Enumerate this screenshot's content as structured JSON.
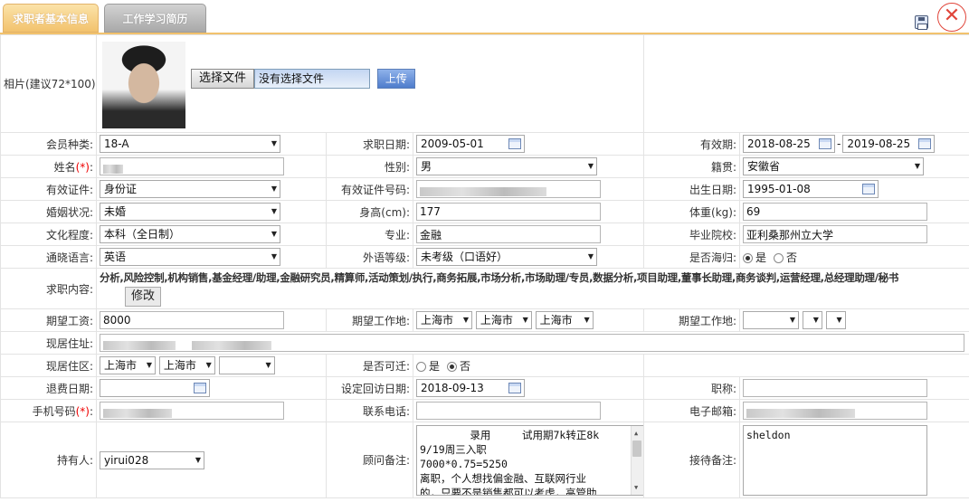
{
  "tabs": [
    "求职者基本信息",
    "工作学习简历"
  ],
  "photo": {
    "label": "相片(建议72*100):",
    "choose_btn": "选择文件",
    "file_status": "没有选择文件",
    "upload_btn": "上传"
  },
  "row1": {
    "member_type_label": "会员种类:",
    "member_type": "18-A",
    "apply_date_label": "求职日期:",
    "apply_date": "2009-05-01",
    "valid_label": "有效期:",
    "valid_from": "2018-08-25",
    "dash": "-",
    "valid_to": "2019-08-25"
  },
  "row2": {
    "name_label": "姓名",
    "req": "(*)",
    "colon": ":",
    "gender_label": "性别:",
    "gender": "男",
    "origin_label": "籍贯:",
    "origin": "安徽省"
  },
  "row3": {
    "id_type_label": "有效证件:",
    "id_type": "身份证",
    "id_no_label": "有效证件号码:",
    "birth_label": "出生日期:",
    "birth": "1995-01-08"
  },
  "row4": {
    "marital_label": "婚姻状况:",
    "marital": "未婚",
    "height_label": "身高(cm):",
    "height": "177",
    "weight_label": "体重(kg):",
    "weight": "69"
  },
  "row5": {
    "edu_label": "文化程度:",
    "edu": "本科（全日制）",
    "major_label": "专业:",
    "major": "金融",
    "school_label": "毕业院校:",
    "school": "亚利桑那州立大学"
  },
  "row6": {
    "lang_label": "通晓语言:",
    "lang": "英语",
    "lang_level_label": "外语等级:",
    "lang_level": "未考级（口语好）",
    "overseas_label": "是否海归:",
    "yes": "是",
    "no": "否"
  },
  "row7": {
    "jobs_label": "求职内容:",
    "jobs": "分析,风险控制,机构销售,基金经理/助理,金融研究员,精算师,活动策划/执行,商务拓展,市场分析,市场助理/专员,数据分析,项目助理,董事长助理,商务谈判,运营经理,总经理助理/秘书",
    "edit_btn": "修改"
  },
  "row8": {
    "salary_label": "期望工资:",
    "salary": "8000",
    "workplace_label": "期望工作地:",
    "wp1": "上海市",
    "wp2": "上海市",
    "wp3": "上海市",
    "workplace2_label": "期望工作地:"
  },
  "row9": {
    "address_label": "现居住址:"
  },
  "row10": {
    "district_label": "现居住区:",
    "d1": "上海市",
    "d2": "上海市",
    "relocate_label": "是否可迁:",
    "yes": "是",
    "no": "否"
  },
  "row11": {
    "refund_label": "退费日期:",
    "revisit_label": "设定回访日期:",
    "revisit": "2018-09-13",
    "title_label": "职称:"
  },
  "row12": {
    "mobile_label": "手机号码",
    "req": "(*)",
    "colon": ":",
    "phone_label": "联系电话:",
    "email_label": "电子邮箱:"
  },
  "row13": {
    "holder_label": "持有人:",
    "holder": "yirui028",
    "consultant_label": "顾问备注:",
    "consultant_note": "        录用     试用期7k转正8k\n9/19周三入职\n7000*0.75=5250\n离职，个人想找偏金融、互联网行业\n的，只要不是销售都可以考虑，高管助",
    "reception_label": "接待备注:",
    "reception_note": "sheldon"
  }
}
